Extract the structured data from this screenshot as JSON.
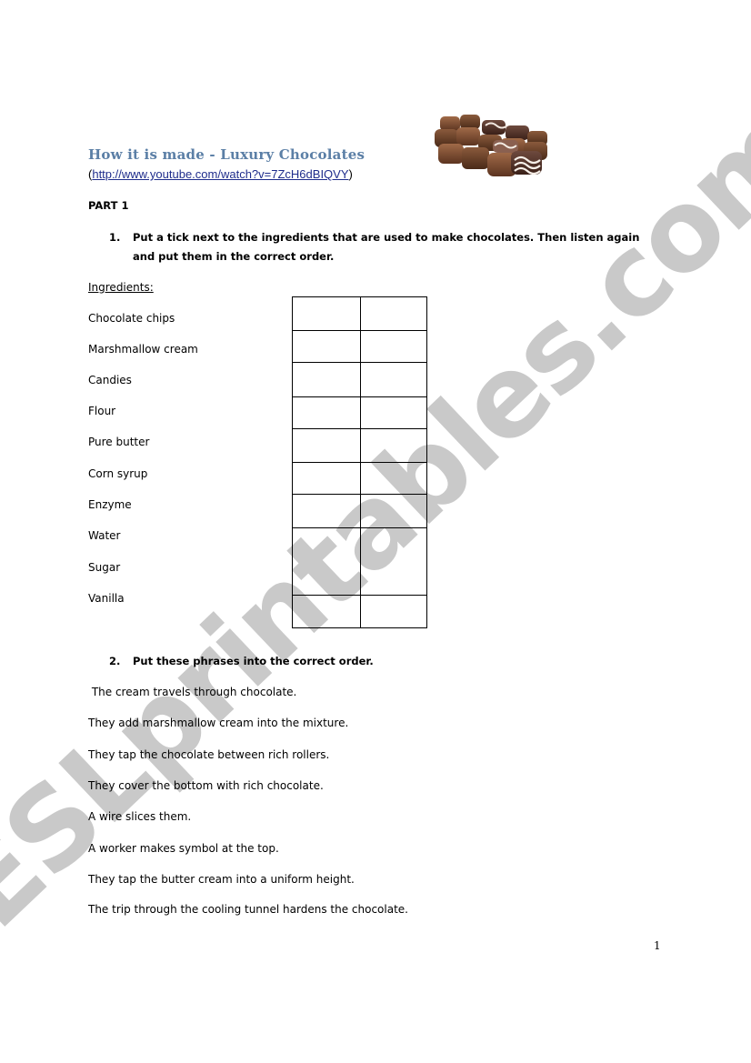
{
  "document": {
    "title": "How it is made - Luxury Chocolates",
    "link_open": "(",
    "link_url_text": "http://www.youtube.com/watch?v=7ZcH6dBIQVY",
    "link_close": ")",
    "image_alt": "Assorted luxury chocolates",
    "part_label": "PART 1",
    "question1": {
      "number": "1.",
      "text": "Put a tick next to the ingredients that are used to make chocolates. Then listen again and put them in the correct order."
    },
    "ingredients_label": "Ingredients:",
    "ingredients": [
      "Chocolate chips",
      "Marshmallow cream",
      "Candies",
      "Flour",
      "Pure butter",
      "Corn syrup",
      "Enzyme",
      "Water",
      "Sugar",
      "Vanilla"
    ],
    "answer_table": {
      "columns": 2,
      "rows": 9,
      "cells": [
        [
          "",
          ""
        ],
        [
          "",
          ""
        ],
        [
          "",
          ""
        ],
        [
          "",
          ""
        ],
        [
          "",
          ""
        ],
        [
          "",
          ""
        ],
        [
          "",
          ""
        ],
        [
          "",
          ""
        ],
        [
          "",
          ""
        ]
      ]
    },
    "question2": {
      "number": "2.",
      "text": "Put these phrases into the correct order."
    },
    "phrases": [
      " The cream travels through chocolate.",
      "They add marshmallow cream into the mixture.",
      "They tap the chocolate between rich rollers.",
      "They cover the bottom with rich chocolate.",
      "A wire slices them.",
      "A worker makes symbol at the top.",
      "They tap the butter cream into a uniform height.",
      "The trip through the cooling tunnel hardens the chocolate."
    ],
    "page_number": "1",
    "watermark": "ESLprintables.com"
  },
  "colors": {
    "title": "#5b7fa6",
    "link": "#1f2d8c",
    "watermark": "#c9c9c9"
  }
}
